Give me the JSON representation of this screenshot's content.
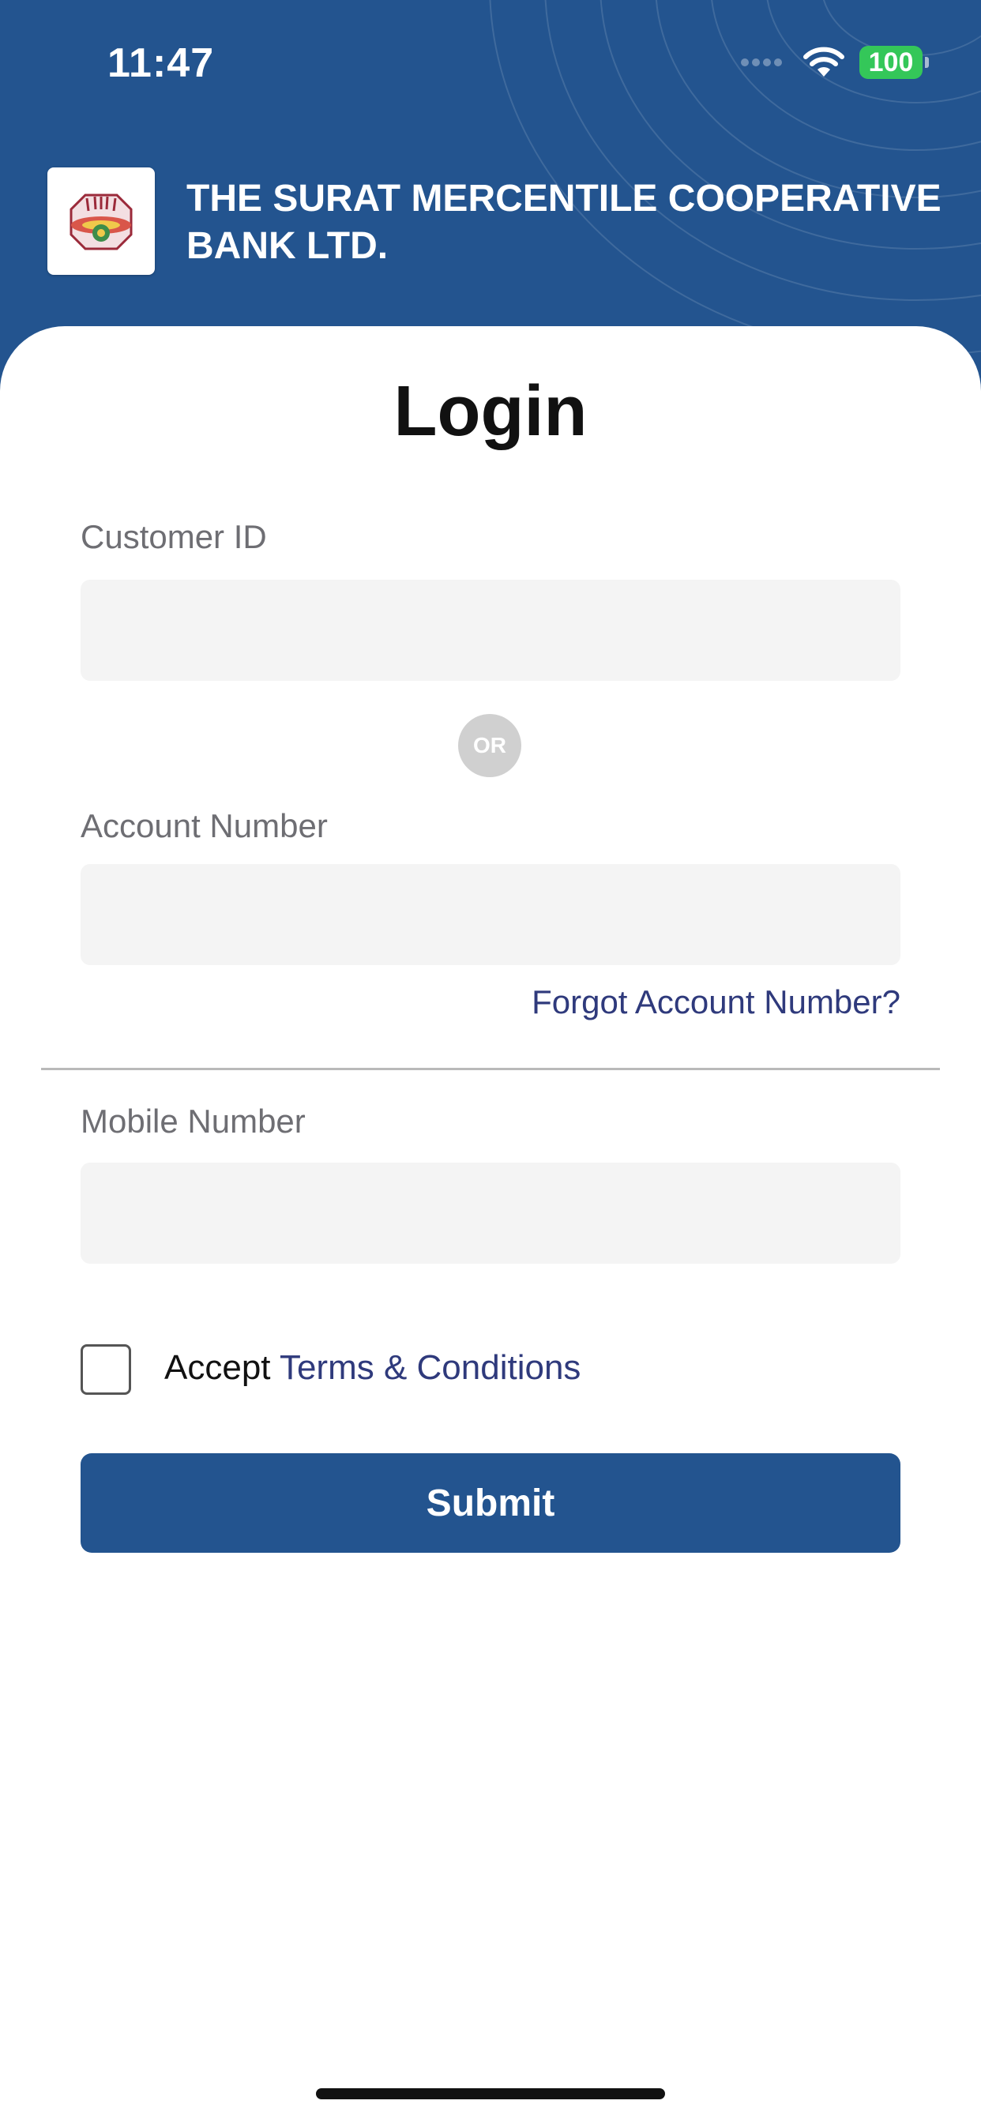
{
  "status_bar": {
    "time": "11:47",
    "battery": "100"
  },
  "header": {
    "bank_name": "THE SURAT MERCENTILE COOPERATIVE BANK LTD."
  },
  "login": {
    "title": "Login",
    "customer_id": {
      "label": "Customer ID",
      "value": "",
      "placeholder": ""
    },
    "or_label": "OR",
    "account_number": {
      "label": "Account Number",
      "value": "",
      "placeholder": ""
    },
    "forgot_link": "Forgot Account Number?",
    "mobile_number": {
      "label": "Mobile Number",
      "value": "",
      "placeholder": ""
    },
    "accept_text": "Accept",
    "terms_link": "Terms & Conditions",
    "submit_label": "Submit"
  },
  "colors": {
    "brand_blue": "#23548f",
    "link_color": "#2f3a7c",
    "battery_green": "#34c759",
    "input_bg": "#f4f4f4"
  }
}
